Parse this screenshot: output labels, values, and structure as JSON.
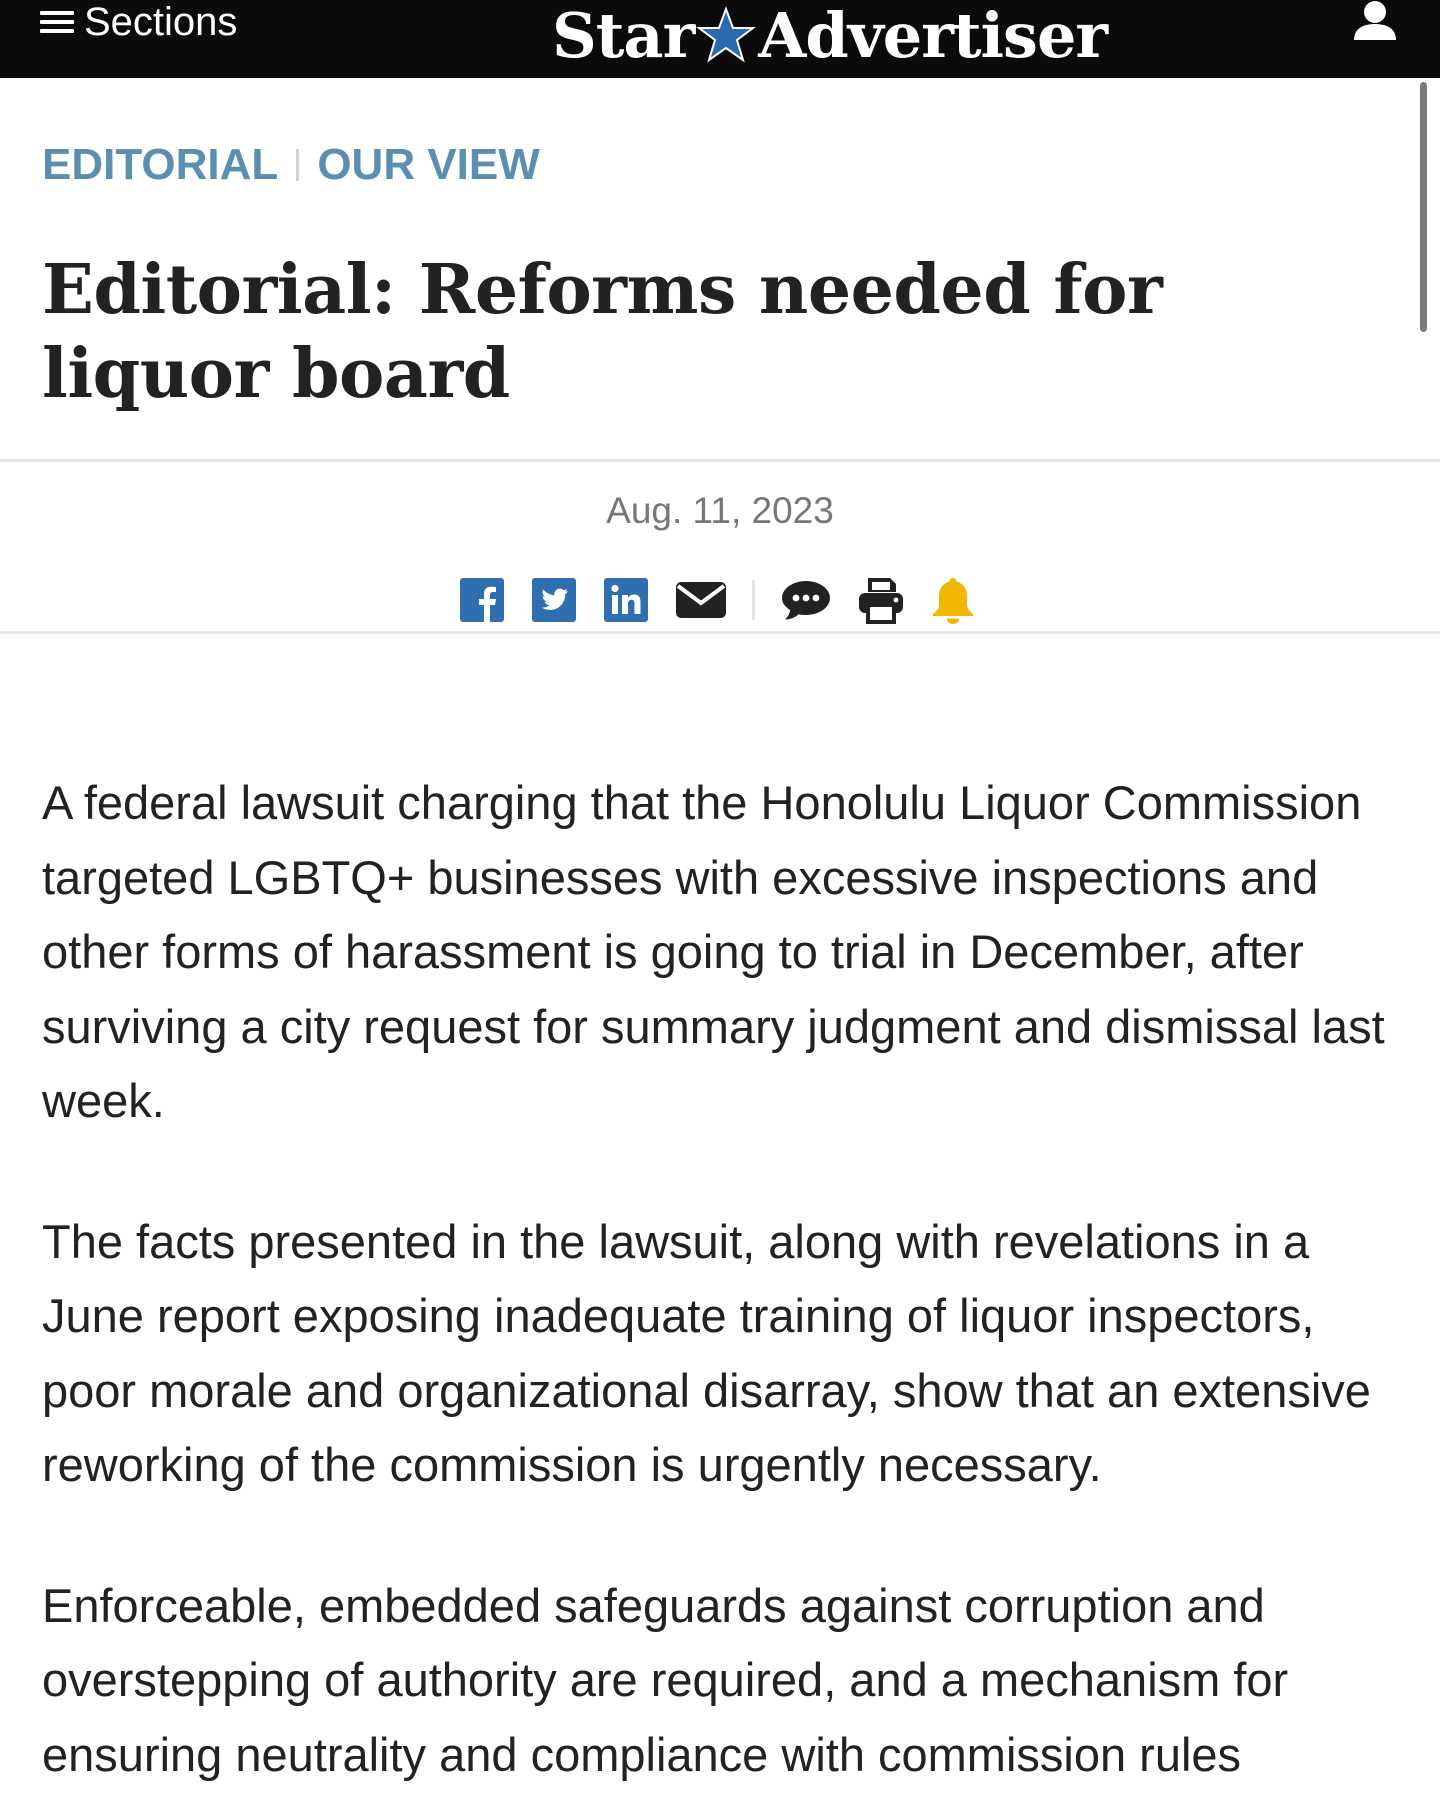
{
  "header": {
    "sections_label": "Sections",
    "logo_left": "Star",
    "logo_right": "Advertiser"
  },
  "kicker": {
    "primary": "EDITORIAL",
    "secondary": "OUR VIEW"
  },
  "headline": "Editorial: Reforms needed for liquor board",
  "dateline": "Aug. 11, 2023",
  "share": {
    "icons": [
      "facebook-icon",
      "twitter-icon",
      "linkedin-icon",
      "email-icon",
      "comment-icon",
      "print-icon",
      "bell-icon"
    ],
    "colors": {
      "social": "#2f6fb0",
      "dark": "#222222",
      "bell": "#f2b705"
    }
  },
  "article": {
    "paragraphs": [
      "A federal lawsuit charging that the Honolulu Liquor Commission targeted LGBTQ+ businesses with excessive inspections and other forms of harassment is going to trial in December, after surviving a city request for summary judgment and dismissal last week.",
      "The facts presented in the lawsuit, along with revelations in a June report exposing inadequate training of liquor inspectors, poor morale and organizational disarray, show that an extensive reworking of the commission is urgently necessary.",
      "Enforceable, embedded safeguards against corruption and overstepping of authority are required, and a mechanism for ensuring neutrality and compliance with commission rules"
    ]
  },
  "colors": {
    "header_bg": "#0b0b0b",
    "kicker": "#5b8fb0",
    "text": "#222222",
    "date": "#777777"
  }
}
